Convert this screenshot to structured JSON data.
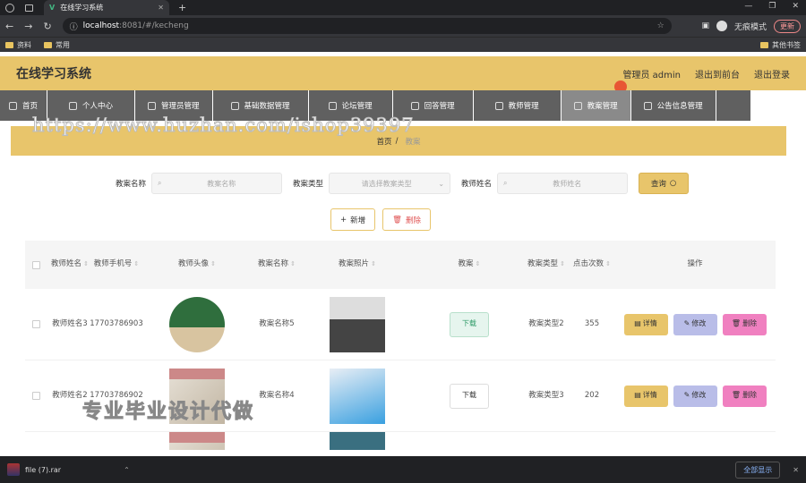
{
  "browser": {
    "tab_title": "在线学习系统",
    "tab_close": "✕",
    "url_host": "localhost",
    "url_path": ":8081/#/kecheng",
    "incognito": "无痕模式",
    "update": "更新",
    "bookmarks": [
      "资料",
      "常用"
    ],
    "other_bookmarks": "其他书签"
  },
  "app": {
    "title": "在线学习系统",
    "user": "管理员 admin",
    "back_front": "退出到前台",
    "logout": "退出登录"
  },
  "menu": [
    "首页",
    "个人中心",
    "管理员管理",
    "基础数据管理",
    "论坛管理",
    "回答管理",
    "教师管理",
    "教案管理",
    "公告信息管理"
  ],
  "active_menu": "教案管理",
  "watermark_url": "https://www.huzhan.com/ishop39397",
  "breadcrumb": {
    "home": "首页",
    "sep": "/",
    "current": "教案"
  },
  "search": {
    "name_label": "教案名称",
    "name_placeholder": "教案名称",
    "type_label": "教案类型",
    "type_placeholder": "请选择教案类型",
    "teacher_label": "教师姓名",
    "teacher_placeholder": "教师姓名",
    "query": "查询"
  },
  "actions": {
    "add": "新增",
    "delete": "删除"
  },
  "table": {
    "headers": [
      "教师姓名",
      "教师手机号",
      "教师头像",
      "教案名称",
      "教案照片",
      "教案",
      "教案类型",
      "点击次数",
      "操作"
    ],
    "rows": [
      {
        "teacher": "教师姓名3",
        "phone": "17703786903",
        "plan": "教案名称5",
        "download": "下载",
        "type": "教案类型2",
        "clicks": "355"
      },
      {
        "teacher": "教师姓名2",
        "phone": "17703786902",
        "plan": "教案名称4",
        "download": "下载",
        "type": "教案类型3",
        "clicks": "202"
      }
    ],
    "op_detail": "详情",
    "op_edit": "修改",
    "op_delete": "删除"
  },
  "watermark_text": "专业毕业设计代做",
  "taskbar": {
    "file": "file (7).rar",
    "show_all": "全部显示"
  }
}
